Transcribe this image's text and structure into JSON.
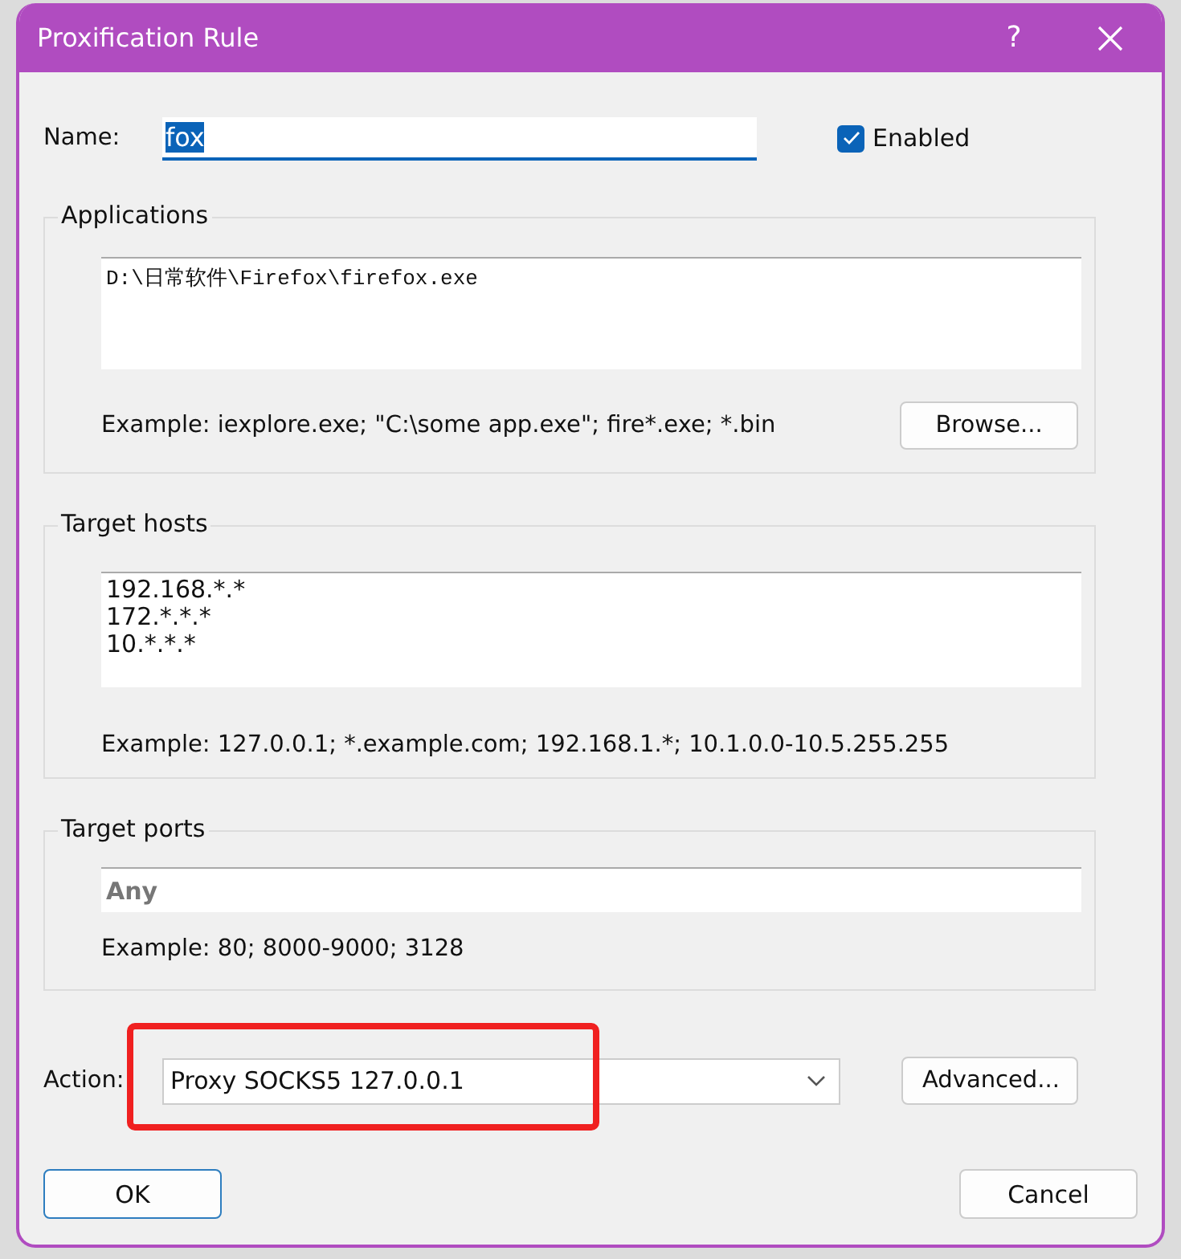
{
  "window": {
    "title": "Proxification Rule",
    "help": "?"
  },
  "name": {
    "label": "Name:",
    "value": "fox",
    "value_selected": true
  },
  "enabled": {
    "label": "Enabled",
    "checked": true
  },
  "applications": {
    "title": "Applications",
    "lines": [
      "D:\\日常软件\\Firefox\\firefox.exe"
    ],
    "example": "Example: iexplore.exe; \"C:\\some app.exe\"; fire*.exe; *.bin",
    "button": "Browse..."
  },
  "target_hosts": {
    "title": "Target hosts",
    "lines": [
      "192.168.*.*",
      "172.*.*.*",
      "10.*.*.*"
    ],
    "example": "Example: 127.0.0.1; *.example.com; 192.168.1.*; 10.1.0.0-10.5.255.255"
  },
  "target_ports": {
    "title": "Target ports",
    "placeholder": "Any",
    "example": "Example: 80; 8000-9000; 3128"
  },
  "action": {
    "label": "Action:",
    "value": "Proxy SOCKS5 127.0.0.1",
    "button": "Advanced...",
    "highlighted": true
  },
  "buttons": [
    {
      "label": "OK",
      "default": true
    },
    {
      "label": "Cancel",
      "default": false
    }
  ]
}
